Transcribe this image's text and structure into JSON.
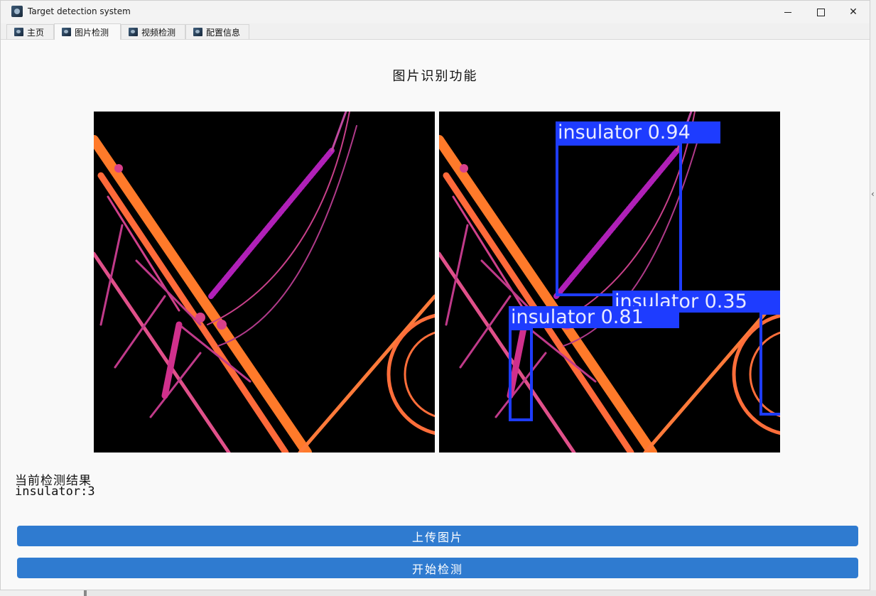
{
  "window": {
    "title": "Target detection system",
    "controls": {
      "minimize": "minimize",
      "maximize": "maximize",
      "close": "✕"
    }
  },
  "tabs": [
    {
      "label": "主页",
      "active": false
    },
    {
      "label": "图片检测",
      "active": true
    },
    {
      "label": "视频检测",
      "active": false
    },
    {
      "label": "配置信息",
      "active": false
    }
  ],
  "page": {
    "title": "图片识别功能"
  },
  "images": {
    "original": {
      "description_icon": "thermal-image"
    },
    "detected": {
      "detections": [
        {
          "label": "insulator 0.94"
        },
        {
          "label": "insulator 0.35"
        },
        {
          "label": "insulator 0.81"
        }
      ]
    }
  },
  "result": {
    "title": "当前检测结果",
    "value": "insulator:3"
  },
  "buttons": {
    "upload": "上传图片",
    "detect": "开始检测"
  },
  "colors": {
    "accent": "#2f7bd0",
    "detection": "#1e3cff"
  }
}
